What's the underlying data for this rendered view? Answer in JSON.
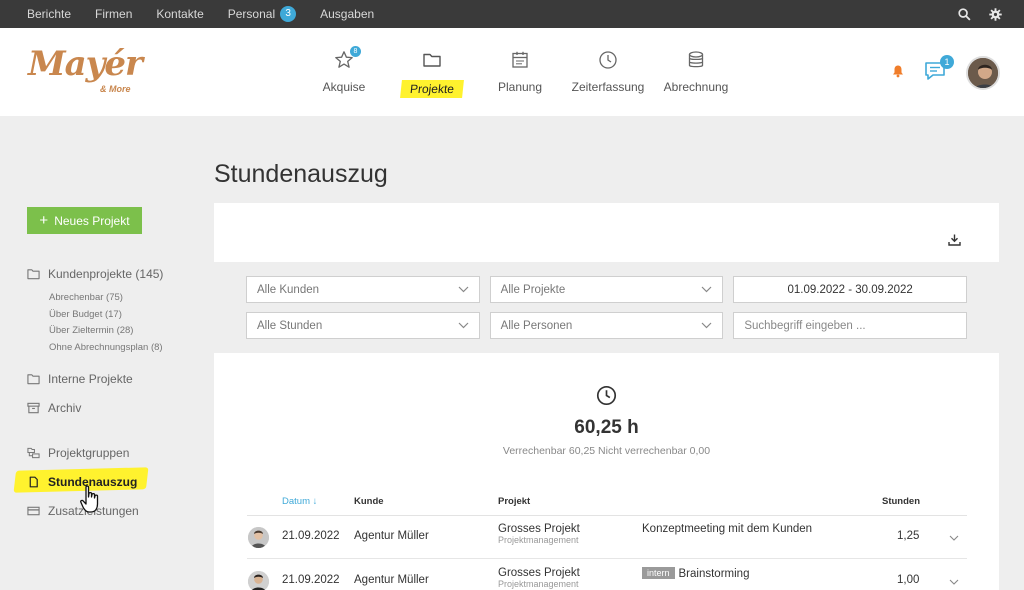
{
  "topbar": {
    "items": [
      {
        "label": "Berichte"
      },
      {
        "label": "Firmen"
      },
      {
        "label": "Kontakte"
      },
      {
        "label": "Personal",
        "badge": "3"
      },
      {
        "label": "Ausgaben"
      }
    ]
  },
  "brand": {
    "name": "Mayér",
    "tagline": "& More",
    "color": "#c9874e"
  },
  "mainnav": {
    "akquise": {
      "label": "Akquise",
      "badge": "8"
    },
    "projekte": {
      "label": "Projekte"
    },
    "planung": {
      "label": "Planung"
    },
    "zeiterfassung": {
      "label": "Zeiterfassung"
    },
    "abrechnung": {
      "label": "Abrechnung"
    }
  },
  "header": {
    "chat_badge": "1"
  },
  "sidebar": {
    "new_project": "Neues Projekt",
    "kundenprojekte": "Kundenprojekte (145)",
    "subs": [
      {
        "label": "Abrechenbar (75)"
      },
      {
        "label": "Über Budget (17)"
      },
      {
        "label": "Über Zieltermin (28)"
      },
      {
        "label": "Ohne Abrechnungsplan (8)"
      }
    ],
    "interne": "Interne Projekte",
    "archiv": "Archiv",
    "gruppen": "Projektgruppen",
    "stundenauszug": "Stundenauszug",
    "zusatz": "Zusatzleistungen"
  },
  "page": {
    "title": "Stundenauszug"
  },
  "filters": {
    "kunden": "Alle Kunden",
    "projekte": "Alle Projekte",
    "zeitraum": "01.09.2022 - 30.09.2022",
    "stunden": "Alle Stunden",
    "personen": "Alle Personen",
    "search_placeholder": "Suchbegriff eingeben ..."
  },
  "summary": {
    "total": "60,25 h",
    "detail": "Verrechenbar 60,25 Nicht verrechenbar 0,00"
  },
  "table": {
    "headers": {
      "datum": "Datum",
      "kunde": "Kunde",
      "projekt": "Projekt",
      "stunden": "Stunden"
    },
    "rows": [
      {
        "datum": "21.09.2022",
        "kunde": "Agentur Müller",
        "projekt": "Grosses Projekt",
        "sub": "Projektmanagement",
        "tag": "",
        "aufgabe": "Konzeptmeeting mit dem Kunden",
        "stunden": "1,25"
      },
      {
        "datum": "21.09.2022",
        "kunde": "Agentur Müller",
        "projekt": "Grosses Projekt",
        "sub": "Projektmanagement",
        "tag": "intern",
        "aufgabe": "Brainstorming",
        "stunden": "1,00"
      }
    ]
  },
  "colors": {
    "accent": "#3fa9d8",
    "green": "#7cc04b",
    "highlight": "#fff22e",
    "topbar": "#3a3a3a"
  }
}
